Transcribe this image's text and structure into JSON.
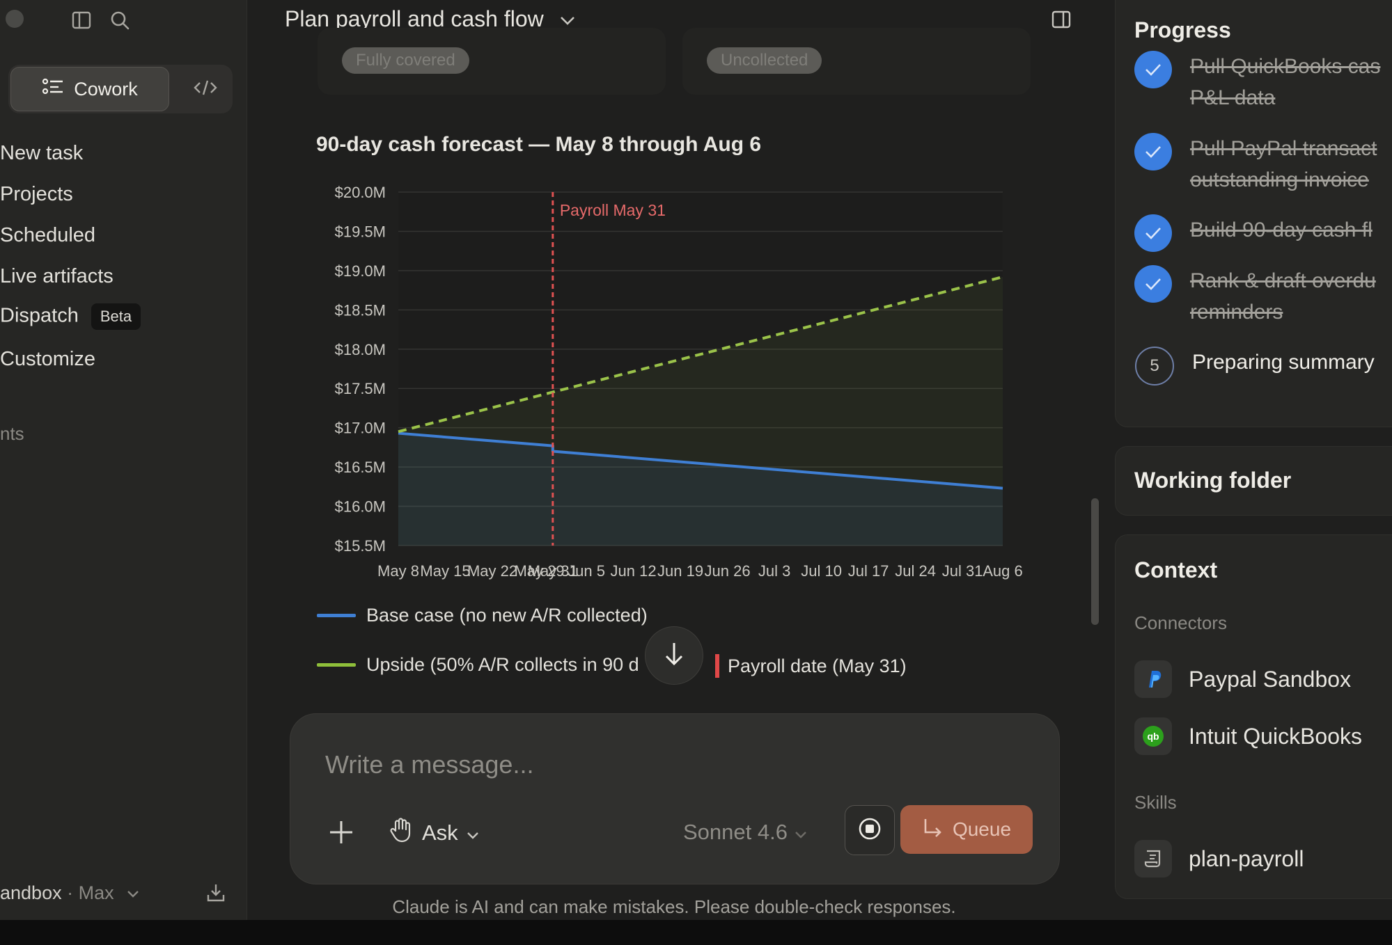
{
  "sidebar": {
    "mode_active": "Cowork",
    "nav": [
      "New task",
      "Projects",
      "Scheduled",
      "Live artifacts",
      "Dispatch",
      "Customize"
    ],
    "beta_badge": "Beta",
    "section_label": "nts",
    "account_name": "andbox",
    "account_sep": " · ",
    "account_plan": "Max"
  },
  "header": {
    "title": "Plan payroll and cash flow"
  },
  "cards_above": {
    "tag_left": "Fully covered",
    "tag_right": "Uncollected"
  },
  "chart_data": {
    "type": "line",
    "title": "90-day cash forecast — May 8 through Aug 6",
    "x_ticks": [
      "May 8",
      "May 15",
      "May 22",
      "May 29",
      "May 31",
      "Jun 5",
      "Jun 12",
      "Jun 19",
      "Jun 26",
      "Jul 3",
      "Jul 10",
      "Jul 17",
      "Jul 24",
      "Jul 31",
      "Aug 6"
    ],
    "y_ticks": [
      "$20.0M",
      "$19.5M",
      "$19.0M",
      "$18.5M",
      "$18.0M",
      "$17.5M",
      "$17.0M",
      "$16.5M",
      "$16.0M",
      "$15.5M"
    ],
    "ylim": [
      15.5,
      20.0
    ],
    "xlim_days": [
      0,
      90
    ],
    "y_unit": "$M",
    "series": [
      {
        "name": "Base case (no new A/R collected)",
        "color": "#3f7fd4",
        "style": "solid",
        "x": [
          "May 8",
          "May 31",
          "May 31",
          "Aug 6"
        ],
        "values": [
          16.93,
          16.77,
          16.7,
          16.23
        ]
      },
      {
        "name": "Upside (50% A/R collects in 90 d",
        "color": "#9bc34a",
        "style": "dashed",
        "x": [
          "May 8",
          "Aug 6"
        ],
        "values": [
          16.95,
          18.92
        ]
      }
    ],
    "annotations": [
      {
        "type": "vline",
        "x": "May 31",
        "label": "Payroll May 31",
        "color": "#e05252"
      }
    ],
    "legend": [
      {
        "label": "Base case (no new A/R collected)",
        "color": "#3f7fd4"
      },
      {
        "label": "Upside (50% A/R collects in 90 d",
        "color": "#8fbf3a"
      },
      {
        "label": "Payroll date (May 31)",
        "color": "#e04848"
      }
    ],
    "grid": true
  },
  "composer": {
    "placeholder": "Write a message...",
    "mode": "Ask",
    "model": "Sonnet 4.6",
    "queue_label": "Queue"
  },
  "disclaimer": "Claude is AI and can make mistakes. Please double-check responses.",
  "progress": {
    "title": "Progress",
    "steps": [
      {
        "lines": [
          "Pull QuickBooks cas",
          "P&L data"
        ],
        "done": true
      },
      {
        "lines": [
          "Pull PayPal transact",
          "outstanding invoice"
        ],
        "done": true
      },
      {
        "lines": [
          "Build 90-day cash fl"
        ],
        "done": true
      },
      {
        "lines": [
          "Rank & draft overdu",
          "reminders"
        ],
        "done": true
      },
      {
        "lines": [
          "Preparing summary"
        ],
        "done": false,
        "number": "5"
      }
    ]
  },
  "working_folder": {
    "title": "Working folder"
  },
  "context": {
    "title": "Context",
    "connectors_label": "Connectors",
    "connectors": [
      "Paypal Sandbox",
      "Intuit QuickBooks"
    ],
    "skills_label": "Skills",
    "skills": [
      "plan-payroll"
    ]
  },
  "colors": {
    "accent": "#a35c43",
    "check": "#3b7ee0",
    "background": "#1f1f1e"
  }
}
